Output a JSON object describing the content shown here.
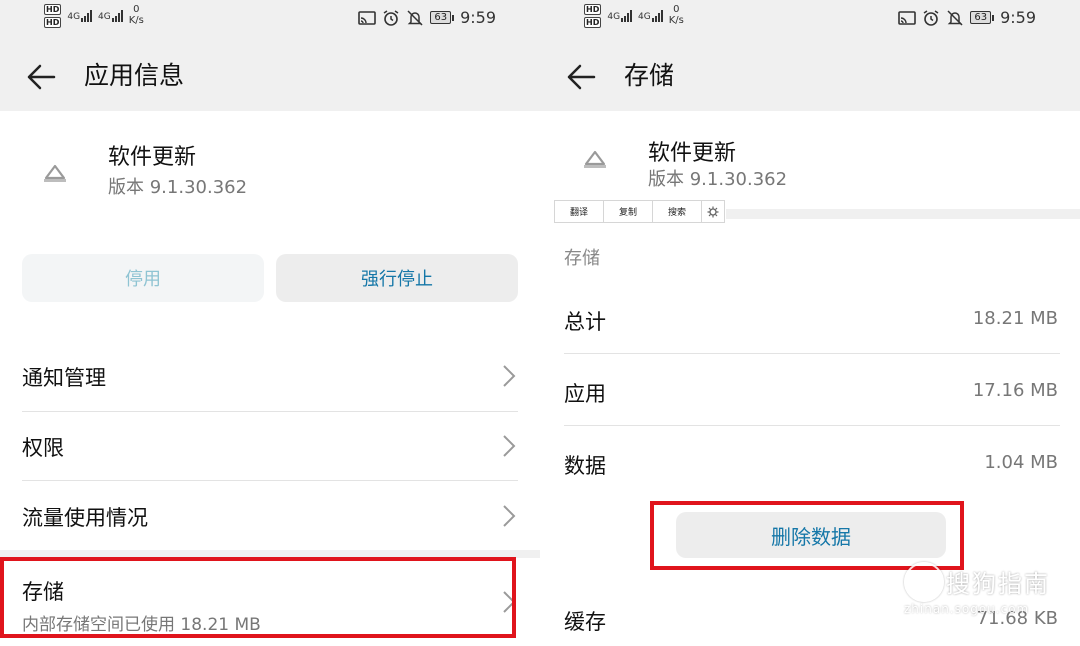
{
  "status_bar": {
    "hd1": "HD",
    "hd2": "HD",
    "net1": "4G",
    "net2": "4G",
    "speed_value": "0",
    "speed_unit": "K/s",
    "battery": "63",
    "time": "9:59"
  },
  "left": {
    "title": "应用信息",
    "app_name": "软件更新",
    "app_version": "版本 9.1.30.362",
    "disable_label": "停用",
    "force_stop_label": "强行停止",
    "items": [
      {
        "label": "通知管理"
      },
      {
        "label": "权限"
      },
      {
        "label": "流量使用情况"
      }
    ],
    "storage": {
      "label": "存储",
      "subtitle": "内部存储空间已使用 18.21 MB"
    }
  },
  "right": {
    "title": "存储",
    "app_name": "软件更新",
    "app_version": "版本 9.1.30.362",
    "context_menu": [
      "翻译",
      "复制",
      "搜索"
    ],
    "section_title": "存储",
    "rows": [
      {
        "label": "总计",
        "value": "18.21 MB"
      },
      {
        "label": "应用",
        "value": "17.16 MB"
      },
      {
        "label": "数据",
        "value": "1.04 MB"
      }
    ],
    "clear_data_label": "删除数据",
    "cache": {
      "label": "缓存",
      "value": "71.68 KB"
    }
  },
  "watermark": {
    "text": "搜狗指南",
    "url": "zhinan.sogou.com"
  },
  "colors": {
    "highlight": "#e0141c",
    "accent": "#1577a8",
    "disabled_text": "#8fc4d3",
    "header_bg": "#f0f0f0"
  },
  "icons": [
    "back-arrow-icon",
    "chevron-right-icon",
    "app-icon",
    "settings-gear-icon",
    "cast-icon",
    "alarm-icon",
    "mute-icon",
    "battery-icon",
    "signal-icon"
  ]
}
